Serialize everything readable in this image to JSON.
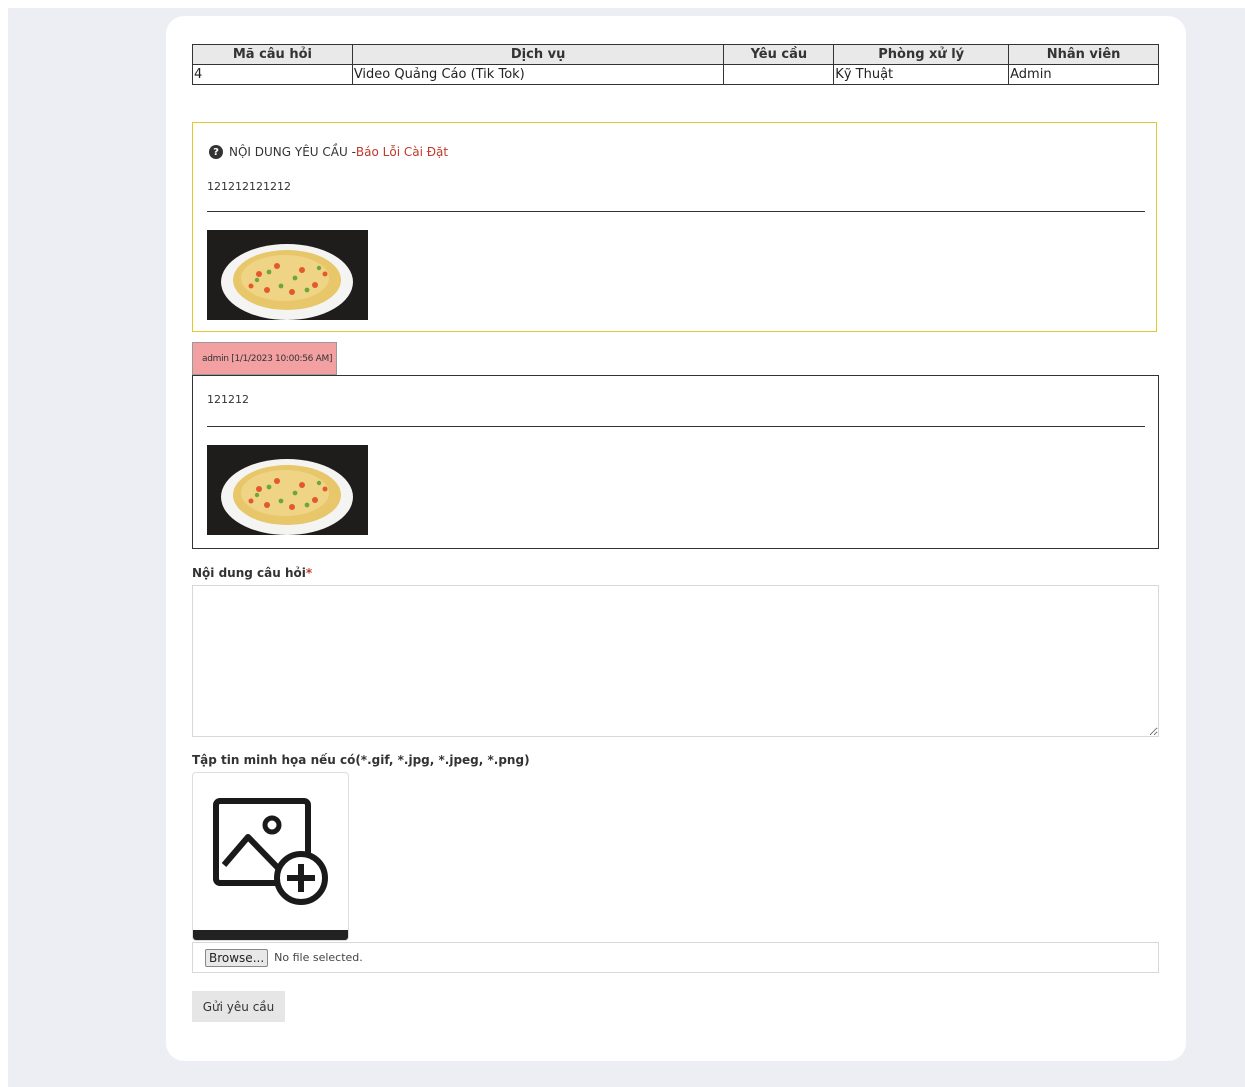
{
  "table": {
    "headers": [
      "Mã câu hỏi",
      "Dịch vụ",
      "Yêu cầu",
      "Phòng xử lý",
      "Nhân viên"
    ],
    "row": [
      "4",
      "Video Quảng Cáo (Tik Tok)",
      "",
      "Kỹ Thuật",
      "Admin"
    ]
  },
  "request": {
    "title_prefix": "NỘI DUNG YÊU CẦU - ",
    "category": "Báo Lỗi Cài Đặt",
    "content": "121212121212"
  },
  "reply": {
    "author_stamp": "admin [1/1/2023 10:00:56 AM]",
    "content": "121212"
  },
  "form": {
    "content_label": "Nội dung câu hỏi",
    "required_mark": "*",
    "attachment_label": "Tập tin minh họa nếu có(*.gif, *.jpg, *.jpeg, *.png)",
    "browse_label": "Browse...",
    "no_file_text": "No file selected.",
    "submit_label": "Gửi yêu cầu"
  },
  "colors": {
    "request_border": "#e3c72c",
    "category_text": "#c0392b",
    "reply_tag_bg": "#f3a0a3"
  }
}
